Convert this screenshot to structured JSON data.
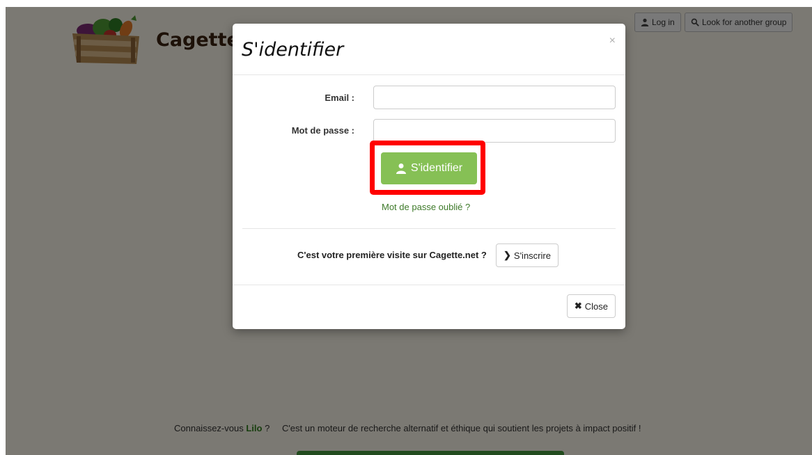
{
  "brand": {
    "name": "Cagette"
  },
  "topbar": {
    "login_label": "Log in",
    "group_label": "Look for another group"
  },
  "footer": {
    "question_prefix": "Connaissez-vous",
    "lilo_link": "Lilo",
    "question_suffix": "?",
    "message": "C'est un moteur de recherche alternatif et éthique qui soutient les projets à impact positif !"
  },
  "modal": {
    "title": "S'identifier",
    "close_x": "×",
    "email_label": "Email :",
    "email_value": "",
    "password_label": "Mot de passe :",
    "password_value": "",
    "submit_label": "S'identifier",
    "forgot_link": "Mot de passe oublié ?",
    "first_visit_text": "C'est votre première visite sur Cagette.net ?",
    "signup_label": "S'inscrire",
    "close_label": "Close"
  },
  "colors": {
    "submit_green": "#86c055",
    "highlight_red": "#ff0000",
    "link_green": "#3e7a2a",
    "footer_green": "#44983d"
  }
}
